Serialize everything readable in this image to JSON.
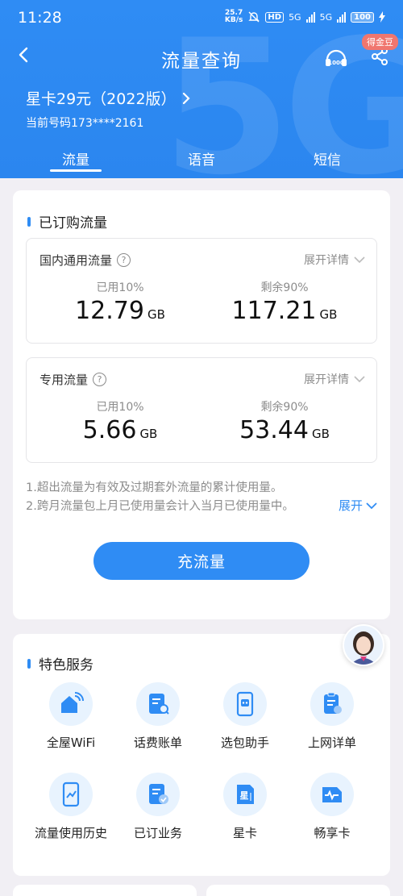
{
  "status": {
    "time": "11:28",
    "speed_value": "25.7",
    "speed_unit": "KB/s",
    "hd": "HD",
    "net1": "5G",
    "net2": "5G",
    "battery": "100"
  },
  "nav": {
    "title": "流量查询",
    "coin_badge": "得金豆"
  },
  "account": {
    "plan_name": "星卡29元（2022版）",
    "phone_line": "当前号码173****2161"
  },
  "tabs": [
    {
      "label": "流量",
      "active": true
    },
    {
      "label": "语音",
      "active": false
    },
    {
      "label": "短信",
      "active": false
    }
  ],
  "subscribed": {
    "title": "已订购流量",
    "boxes": [
      {
        "title": "国内通用流量",
        "help": "?",
        "expand": "展开详情",
        "used_label": "已用10%",
        "used_value": "12.79",
        "used_unit": "GB",
        "remain_label": "剩余90%",
        "remain_value": "117.21",
        "remain_unit": "GB"
      },
      {
        "title": "专用流量",
        "help": "?",
        "expand": "展开详情",
        "used_label": "已用10%",
        "used_value": "5.66",
        "used_unit": "GB",
        "remain_label": "剩余90%",
        "remain_value": "53.44",
        "remain_unit": "GB"
      }
    ],
    "notes": [
      "1.超出流量为有效及过期套外流量的累计使用量。",
      "2.跨月流量包上月已使用量会计入当月已使用量中。"
    ],
    "expand_link": "展开",
    "recharge_button": "充流量"
  },
  "services": {
    "title": "特色服务",
    "items": [
      {
        "label": "全屋WiFi",
        "icon": "home-wifi-icon"
      },
      {
        "label": "话费账单",
        "icon": "bill-search-icon"
      },
      {
        "label": "选包助手",
        "icon": "package-assistant-icon"
      },
      {
        "label": "上网详单",
        "icon": "data-detail-icon"
      },
      {
        "label": "流量使用历史",
        "icon": "usage-history-icon"
      },
      {
        "label": "已订业务",
        "icon": "subscribed-services-icon"
      },
      {
        "label": "星卡",
        "icon": "star-card-icon"
      },
      {
        "label": "畅享卡",
        "icon": "enjoy-card-icon"
      }
    ]
  },
  "colors": {
    "brand_blue": "#2f8cf4",
    "icon_bg": "#e8f3fe",
    "badge_red": "#f0766e"
  }
}
